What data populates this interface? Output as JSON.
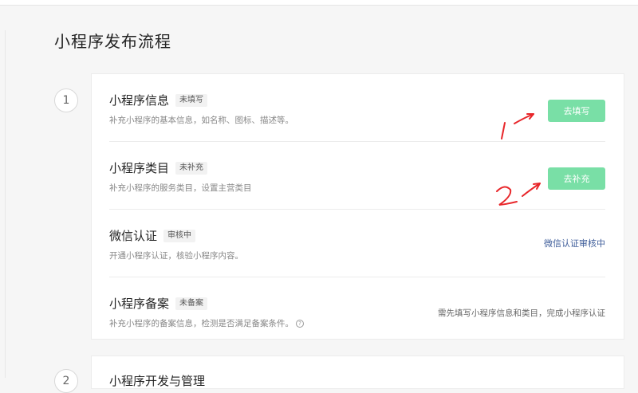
{
  "page": {
    "title": "小程序发布流程"
  },
  "steps": [
    {
      "number": "1"
    },
    {
      "number": "2"
    }
  ],
  "items": [
    {
      "title": "小程序信息",
      "badge": "未填写",
      "desc": "补充小程序的基本信息，如名称、图标、描述等。",
      "action": "去填写"
    },
    {
      "title": "小程序类目",
      "badge": "未补充",
      "desc": "补充小程序的服务类目，设置主营类目",
      "action": "去补充"
    },
    {
      "title": "微信认证",
      "badge": "审核中",
      "desc": "开通小程序认证，核验小程序内容。",
      "status": "微信认证审核中"
    },
    {
      "title": "小程序备案",
      "badge": "未备案",
      "desc": "补充小程序的备案信息，检测是否满足备案条件。",
      "notice": "需先填写小程序信息和类目，完成小程序认证",
      "help": "?"
    }
  ],
  "section2": {
    "title": "小程序开发与管理"
  },
  "annotations": {
    "mark1": "1",
    "mark2": "2",
    "color": "#e8262a"
  },
  "colors": {
    "button_bg": "#79dfa6",
    "link": "#3e5d9a"
  }
}
